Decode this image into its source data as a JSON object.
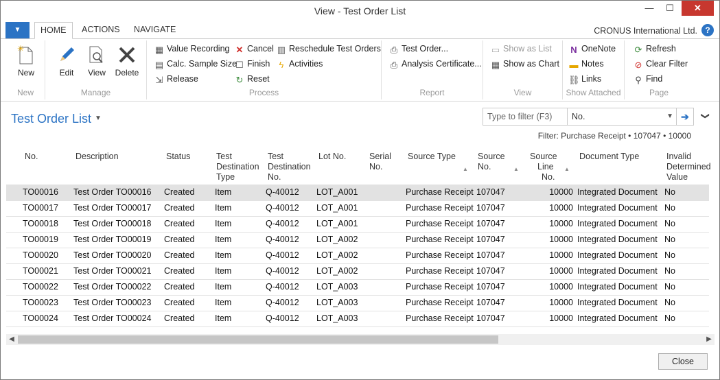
{
  "window": {
    "title": "View - Test Order List",
    "minimize": "—",
    "maximize": "☐",
    "close": "✕"
  },
  "ribbon_tabs": {
    "app_menu": "▼",
    "home": "HOME",
    "actions": "ACTIONS",
    "navigate": "NAVIGATE"
  },
  "company": "CRONUS International Ltd.",
  "help": "?",
  "ribbon": {
    "new": {
      "label": "New",
      "group": "New"
    },
    "manage": {
      "edit": "Edit",
      "view": "View",
      "delete": "Delete",
      "group": "Manage"
    },
    "process": {
      "value_recording": "Value Recording",
      "calc_sample_size": "Calc. Sample Size",
      "release": "Release",
      "cancel": "Cancel",
      "finish": "Finish",
      "reset": "Reset",
      "reschedule": "Reschedule Test Orders",
      "activities": "Activities",
      "group": "Process"
    },
    "report": {
      "test_order": "Test Order...",
      "analysis_certificate": "Analysis Certificate...",
      "group": "Report"
    },
    "view": {
      "show_as_list": "Show as List",
      "show_as_chart": "Show as Chart",
      "group": "View"
    },
    "show_attached": {
      "onenote": "OneNote",
      "notes": "Notes",
      "links": "Links",
      "group": "Show Attached"
    },
    "page": {
      "refresh": "Refresh",
      "clear_filter": "Clear Filter",
      "find": "Find",
      "group": "Page"
    }
  },
  "page": {
    "title": "Test Order List",
    "title_arrow": "▼",
    "collapse": "❯"
  },
  "filter": {
    "placeholder": "Type to filter (F3)",
    "field": "No.",
    "field_arrow": "▼",
    "go": "➔",
    "summary": "Filter: Purchase Receipt • 107047 • 10000"
  },
  "columns": {
    "no": "No.",
    "description": "Description",
    "status": "Status",
    "test_dest_type": [
      "Test",
      "Destination",
      "Type"
    ],
    "test_dest_no": [
      "Test",
      "Destination",
      "No."
    ],
    "lot_no": "Lot No.",
    "serial_no": [
      "Serial",
      "No."
    ],
    "source_type": "Source Type",
    "source_no": [
      "Source",
      "No."
    ],
    "source_line_no": [
      "Source",
      "Line",
      "No."
    ],
    "document_type": "Document Type",
    "invalid_value": [
      "Invalid",
      "Determined",
      "Value"
    ],
    "sort_arrow": "▲"
  },
  "rows": [
    {
      "no": "TO00016",
      "description": "Test Order TO00016",
      "status": "Created",
      "dest_type": "Item",
      "dest_no": "Q-40012",
      "lot": "LOT_A001",
      "serial": "",
      "source_type": "Purchase Receipt",
      "source_no": "107047",
      "line_no": "10000",
      "doc_type": "Integrated Document",
      "invalid": "No"
    },
    {
      "no": "TO00017",
      "description": "Test Order TO00017",
      "status": "Created",
      "dest_type": "Item",
      "dest_no": "Q-40012",
      "lot": "LOT_A001",
      "serial": "",
      "source_type": "Purchase Receipt",
      "source_no": "107047",
      "line_no": "10000",
      "doc_type": "Integrated Document",
      "invalid": "No"
    },
    {
      "no": "TO00018",
      "description": "Test Order TO00018",
      "status": "Created",
      "dest_type": "Item",
      "dest_no": "Q-40012",
      "lot": "LOT_A001",
      "serial": "",
      "source_type": "Purchase Receipt",
      "source_no": "107047",
      "line_no": "10000",
      "doc_type": "Integrated Document",
      "invalid": "No"
    },
    {
      "no": "TO00019",
      "description": "Test Order TO00019",
      "status": "Created",
      "dest_type": "Item",
      "dest_no": "Q-40012",
      "lot": "LOT_A002",
      "serial": "",
      "source_type": "Purchase Receipt",
      "source_no": "107047",
      "line_no": "10000",
      "doc_type": "Integrated Document",
      "invalid": "No"
    },
    {
      "no": "TO00020",
      "description": "Test Order TO00020",
      "status": "Created",
      "dest_type": "Item",
      "dest_no": "Q-40012",
      "lot": "LOT_A002",
      "serial": "",
      "source_type": "Purchase Receipt",
      "source_no": "107047",
      "line_no": "10000",
      "doc_type": "Integrated Document",
      "invalid": "No"
    },
    {
      "no": "TO00021",
      "description": "Test Order TO00021",
      "status": "Created",
      "dest_type": "Item",
      "dest_no": "Q-40012",
      "lot": "LOT_A002",
      "serial": "",
      "source_type": "Purchase Receipt",
      "source_no": "107047",
      "line_no": "10000",
      "doc_type": "Integrated Document",
      "invalid": "No"
    },
    {
      "no": "TO00022",
      "description": "Test Order TO00022",
      "status": "Created",
      "dest_type": "Item",
      "dest_no": "Q-40012",
      "lot": "LOT_A003",
      "serial": "",
      "source_type": "Purchase Receipt",
      "source_no": "107047",
      "line_no": "10000",
      "doc_type": "Integrated Document",
      "invalid": "No"
    },
    {
      "no": "TO00023",
      "description": "Test Order TO00023",
      "status": "Created",
      "dest_type": "Item",
      "dest_no": "Q-40012",
      "lot": "LOT_A003",
      "serial": "",
      "source_type": "Purchase Receipt",
      "source_no": "107047",
      "line_no": "10000",
      "doc_type": "Integrated Document",
      "invalid": "No"
    },
    {
      "no": "TO00024",
      "description": "Test Order TO00024",
      "status": "Created",
      "dest_type": "Item",
      "dest_no": "Q-40012",
      "lot": "LOT_A003",
      "serial": "",
      "source_type": "Purchase Receipt",
      "source_no": "107047",
      "line_no": "10000",
      "doc_type": "Integrated Document",
      "invalid": "No"
    }
  ],
  "selected_row": 0,
  "scroll": {
    "left": "◀",
    "right": "▶"
  },
  "close_button": "Close",
  "colors": {
    "accent": "#2b73c4",
    "close": "#c7372f",
    "selected_row": "#e2e2e2"
  }
}
